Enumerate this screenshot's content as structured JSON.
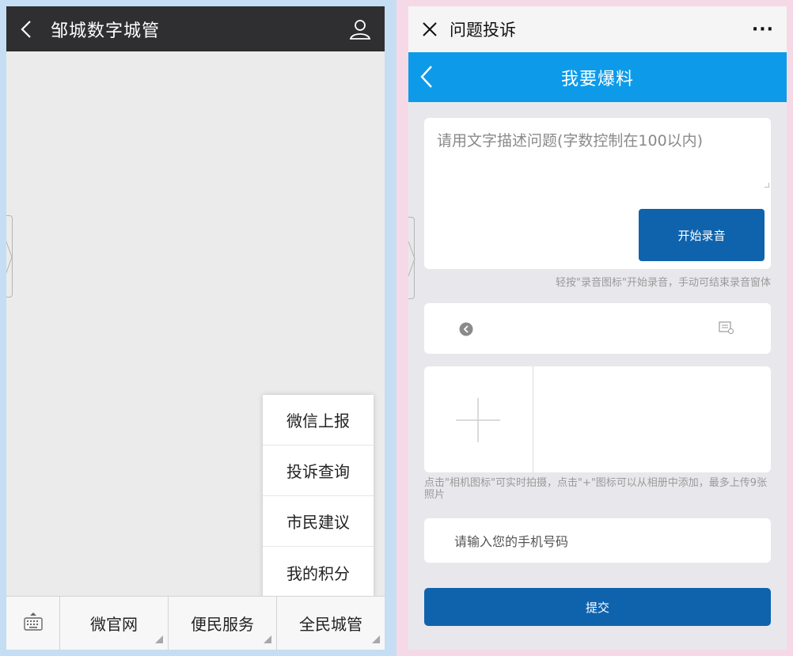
{
  "left": {
    "header": {
      "title": "邹城数字城管"
    },
    "popup": {
      "items": [
        "微信上报",
        "投诉查询",
        "市民建议",
        "我的积分"
      ]
    },
    "bottom_menu": [
      "微官网",
      "便民服务",
      "全民城管"
    ]
  },
  "right": {
    "header": {
      "title": "问题投诉",
      "more": "···"
    },
    "app_bar": {
      "title": "我要爆料"
    },
    "description_placeholder": "请用文字描述问题(字数控制在100以内)",
    "record_button": "开始录音",
    "record_tip": "轻按\"录音图标\"开始录音，手动可结束录音窗体",
    "photo_tip": "点击\"相机图标\"可实时拍摄，点击\"+\"图标可以从相册中添加，最多上传9张照片",
    "phone_placeholder": "请输入您的手机号码",
    "submit_button": "提交"
  },
  "colors": {
    "wechat_header": "#2f2f31",
    "app_bar": "#0d9be9",
    "primary_button": "#0f63ad",
    "left_bg": "#c5def3",
    "right_bg": "#f6d9e6"
  },
  "icons": {
    "left_back": "chevron-left-icon",
    "user": "user-icon",
    "keyboard": "keyboard-icon",
    "close": "close-icon",
    "more": "more-icon",
    "app_back": "chevron-left-icon",
    "play": "play-icon",
    "file": "file-icon",
    "add": "plus-icon"
  }
}
